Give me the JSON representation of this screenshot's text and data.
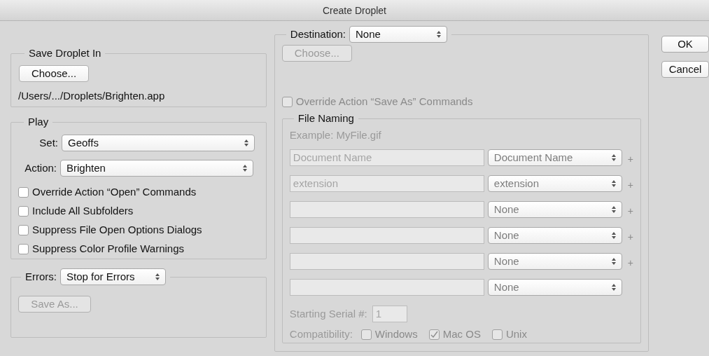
{
  "window": {
    "title": "Create Droplet"
  },
  "save_droplet_in": {
    "legend": "Save Droplet In",
    "choose_button": {
      "label": "Choose...",
      "disabled": false
    },
    "path": "/Users/.../Droplets/Brighten.app"
  },
  "play": {
    "legend": "Play",
    "set": {
      "label": "Set:",
      "value": "Geoffs"
    },
    "action": {
      "label": "Action:",
      "value": "Brighten"
    },
    "options": [
      {
        "label": "Override Action “Open” Commands",
        "checked": false
      },
      {
        "label": "Include All Subfolders",
        "checked": false
      },
      {
        "label": "Suppress File Open Options Dialogs",
        "checked": false
      },
      {
        "label": "Suppress Color Profile Warnings",
        "checked": false
      }
    ]
  },
  "errors": {
    "label": "Errors:",
    "value": "Stop for Errors",
    "save_as_button": {
      "label": "Save As...",
      "disabled": true
    }
  },
  "destination": {
    "label": "Destination:",
    "value": "None",
    "choose_button": {
      "label": "Choose...",
      "disabled": true
    },
    "override_save_as": {
      "label": "Override Action “Save As” Commands",
      "checked": false,
      "disabled": true
    },
    "file_naming": {
      "legend": "File Naming",
      "disabled": true,
      "example": "Example: MyFile.gif",
      "rows": [
        {
          "value": "Document Name",
          "select": "Document Name",
          "plus": "+"
        },
        {
          "value": "extension",
          "select": "extension",
          "plus": "+"
        },
        {
          "select": "None",
          "plus": "+"
        },
        {
          "select": "None",
          "plus": "+"
        },
        {
          "select": "None",
          "plus": "+"
        },
        {
          "select": "None"
        }
      ],
      "starting_serial": {
        "label": "Starting Serial #:",
        "value": "1"
      },
      "compatibility": {
        "label": "Compatibility:",
        "options": [
          {
            "label": "Windows",
            "checked": false
          },
          {
            "label": "Mac OS",
            "checked": true
          },
          {
            "label": "Unix",
            "checked": false
          }
        ]
      }
    }
  },
  "buttons": [
    {
      "label": "OK"
    },
    {
      "label": "Cancel"
    }
  ]
}
